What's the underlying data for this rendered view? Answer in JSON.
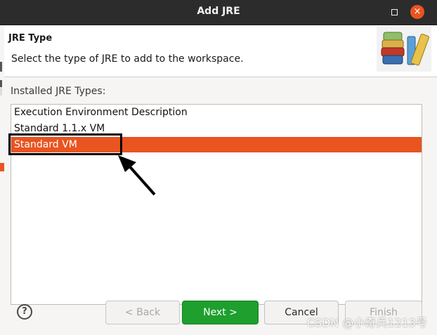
{
  "window": {
    "title": "Add JRE",
    "maximize_icon": "maximize-icon",
    "close_icon": "close-icon",
    "close_glyph": "×"
  },
  "header": {
    "title": "JRE Type",
    "description": "Select the type of JRE to add to the workspace.",
    "banner_icon": "books-icon"
  },
  "jre_types": {
    "label": "Installed JRE Types:",
    "items": [
      {
        "label": "Execution Environment Description",
        "selected": false
      },
      {
        "label": "Standard 1.1.x VM",
        "selected": false
      },
      {
        "label": "Standard VM",
        "selected": true
      }
    ]
  },
  "buttons": {
    "help": "?",
    "back": "< Back",
    "next": "Next >",
    "cancel": "Cancel",
    "finish": "Finish"
  },
  "watermark": "CSDN @小奇兵1213号",
  "colors": {
    "selection": "#e95420",
    "primary_button": "#1e9f2e",
    "titlebar": "#2c2c2c",
    "annotation": "#000000"
  }
}
